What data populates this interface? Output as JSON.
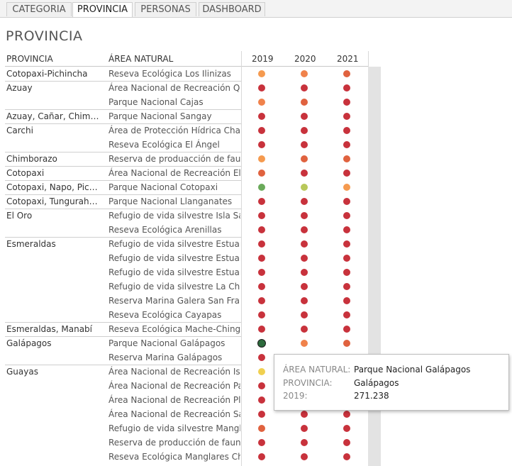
{
  "tabs": [
    {
      "label": "CATEGORIA",
      "active": false
    },
    {
      "label": "PROVINCIA",
      "active": true
    },
    {
      "label": "PERSONAS",
      "active": false
    },
    {
      "label": "DASHBOARD",
      "active": false
    }
  ],
  "page_title": "PROVINCIA",
  "headers": {
    "provincia": "PROVINCIA",
    "area": "ÁREA NATURAL",
    "years": [
      "2019",
      "2020",
      "2021"
    ]
  },
  "colors": {
    "red": "#c8323c",
    "orange": "#f0824b",
    "lightorange": "#f59a4f",
    "redorange": "#e0623f",
    "green": "#6aaa5a",
    "yellowgreen": "#b8c85a",
    "yellow": "#f0d050",
    "darkgreen": "#2d6a3c"
  },
  "rows": [
    {
      "prov": " Cotopaxi-Pichincha",
      "area": "Reseva Ecológica Los Ilinizas",
      "dots": [
        "lightorange",
        "orange",
        "redorange"
      ],
      "group_start": true
    },
    {
      "prov": "Azuay",
      "area": "Área Nacional de Recreación  Q...",
      "dots": [
        "red",
        "red",
        "red"
      ],
      "group_start": true
    },
    {
      "prov": "",
      "area": "Parque Nacional Cajas",
      "dots": [
        "orange",
        "redorange",
        "red"
      ],
      "group_start": false
    },
    {
      "prov": "Azuay, Cañar, Chimbor..",
      "area": "Parque Nacional Sangay",
      "dots": [
        "red",
        "red",
        "red"
      ],
      "group_start": true
    },
    {
      "prov": "Carchi",
      "area": "Área de Protección Hídrica Chal...",
      "dots": [
        "red",
        "red",
        "red"
      ],
      "group_start": true
    },
    {
      "prov": "",
      "area": "Reseva Ecológica El Ángel",
      "dots": [
        "red",
        "red",
        "red"
      ],
      "group_start": false
    },
    {
      "prov": "Chimborazo",
      "area": "Reserva de produacción de faun...",
      "dots": [
        "lightorange",
        "redorange",
        "redorange"
      ],
      "group_start": true
    },
    {
      "prov": "Cotopaxi",
      "area": "Área Nacional de Recreación  El ...",
      "dots": [
        "redorange",
        "red",
        "red"
      ],
      "group_start": true
    },
    {
      "prov": "Cotopaxi, Napo, Pichin..",
      "area": "Parque Nacional Cotopaxi",
      "dots": [
        "green",
        "yellowgreen",
        "lightorange"
      ],
      "group_start": true
    },
    {
      "prov": "Cotopaxi, Tungurahua,..",
      "area": "Parque Nacional Llanganates",
      "dots": [
        "red",
        "red",
        "red"
      ],
      "group_start": true
    },
    {
      "prov": "El Oro",
      "area": "Refugio de vida silvestre Isla Sa...",
      "dots": [
        "red",
        "red",
        "red"
      ],
      "group_start": true
    },
    {
      "prov": "",
      "area": "Reseva Ecológica Arenillas",
      "dots": [
        "red",
        "red",
        "red"
      ],
      "group_start": false
    },
    {
      "prov": "Esmeraldas",
      "area": "Refugio de vida silvestre Estuar...",
      "dots": [
        "red",
        "red",
        "red"
      ],
      "group_start": true
    },
    {
      "prov": "",
      "area": "Refugio de vida silvestre Estuar...",
      "dots": [
        "red",
        "red",
        "red"
      ],
      "group_start": false
    },
    {
      "prov": "",
      "area": "Refugio de vida silvestre Estuar...",
      "dots": [
        "red",
        "red",
        "red"
      ],
      "group_start": false
    },
    {
      "prov": "",
      "area": "Refugio de vida silvestre La Chi...",
      "dots": [
        "red",
        "red",
        "red"
      ],
      "group_start": false
    },
    {
      "prov": "",
      "area": "Reserva Marina Galera San Fra...",
      "dots": [
        "red",
        "red",
        "red"
      ],
      "group_start": false
    },
    {
      "prov": "",
      "area": "Reseva Ecológica Cayapas",
      "dots": [
        "red",
        "red",
        "red"
      ],
      "group_start": false
    },
    {
      "prov": "Esmeraldas, Manabí",
      "area": "Reseva Ecológica Mache-Chingul",
      "dots": [
        "red",
        "red",
        "red"
      ],
      "group_start": true
    },
    {
      "prov": "Galápagos",
      "area": "Parque Nacional Galápagos",
      "dots": [
        "darkgreen",
        "orange",
        "redorange"
      ],
      "group_start": true
    },
    {
      "prov": "",
      "area": "Reserva Marina Galápagos",
      "dots": [
        "red",
        "red",
        "red"
      ],
      "group_start": false
    },
    {
      "prov": "Guayas",
      "area": "Área Nacional de Recreación Isl...",
      "dots": [
        "yellow",
        "red",
        "red"
      ],
      "group_start": true
    },
    {
      "prov": "",
      "area": "Área Nacional de Recreación Pa...",
      "dots": [
        "red",
        "red",
        "red"
      ],
      "group_start": false
    },
    {
      "prov": "",
      "area": "Área Nacional de Recreación Pl...",
      "dots": [
        "red",
        "red",
        "red"
      ],
      "group_start": false
    },
    {
      "prov": "",
      "area": "Área Nacional de Recreación Sa...",
      "dots": [
        "red",
        "red",
        "red"
      ],
      "group_start": false
    },
    {
      "prov": "",
      "area": "Refugio de vida silvestre Mangl...",
      "dots": [
        "redorange",
        "red",
        "red"
      ],
      "group_start": false
    },
    {
      "prov": "",
      "area": "Reserva de producción de fauna...",
      "dots": [
        "red",
        "red",
        "red"
      ],
      "group_start": false
    },
    {
      "prov": "",
      "area": "Reseva Ecológica Manglares Ch...",
      "dots": [
        "red",
        "red",
        "red"
      ],
      "group_start": false
    }
  ],
  "tooltip": {
    "area_label": "ÁREA NATURAL:",
    "area_value": "Parque Nacional Galápagos",
    "prov_label": "PROVINCIA:",
    "prov_value": "Galápagos",
    "year_label": "2019:",
    "year_value": "271.238"
  }
}
